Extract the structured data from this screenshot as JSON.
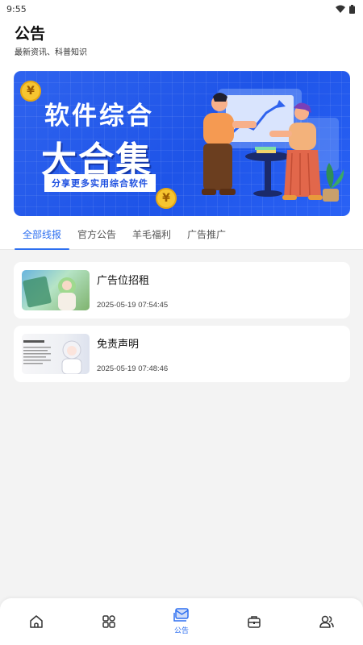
{
  "status_bar": {
    "time": "9:55"
  },
  "header": {
    "title": "公告",
    "subtitle": "最新资讯、科普知识"
  },
  "banner": {
    "line1": "软件综合",
    "line2": "大合集",
    "tagline": "分享更多实用综合软件",
    "coin_symbol": "¥"
  },
  "tabs": [
    {
      "label": "全部线报",
      "active": true
    },
    {
      "label": "官方公告",
      "active": false
    },
    {
      "label": "羊毛福利",
      "active": false
    },
    {
      "label": "广告推广",
      "active": false
    }
  ],
  "announcements": [
    {
      "title": "广告位招租",
      "date": "2025-05-19 07:54:45"
    },
    {
      "title": "免责声明",
      "date": "2025-05-19 07:48:46"
    }
  ],
  "bottom_nav": {
    "items": [
      {
        "icon": "home-icon",
        "label": ""
      },
      {
        "icon": "grid-icon",
        "label": ""
      },
      {
        "icon": "announcement-icon",
        "label": "公告",
        "active": true
      },
      {
        "icon": "toolbox-icon",
        "label": ""
      },
      {
        "icon": "users-icon",
        "label": ""
      }
    ]
  },
  "colors": {
    "accent": "#2d6ff0",
    "banner_blue": "#1e54e8",
    "coin": "#f6c530"
  }
}
